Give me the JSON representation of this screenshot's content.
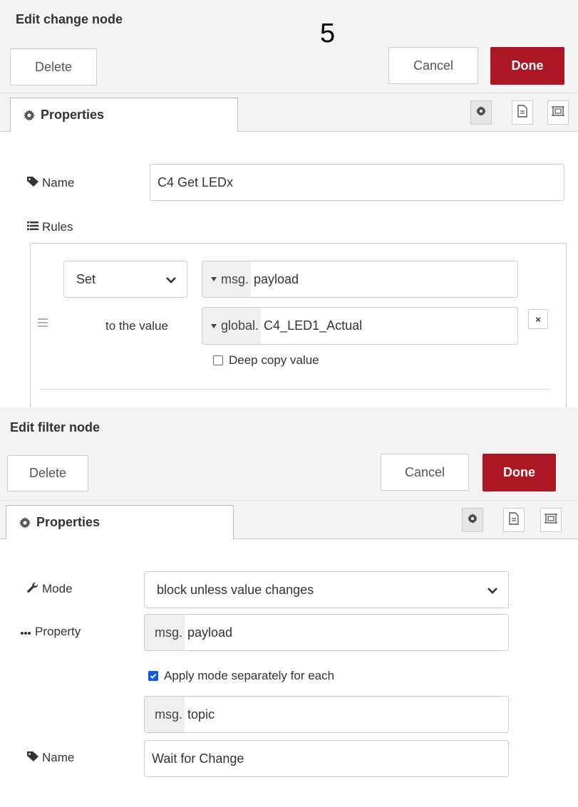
{
  "page_number": "5",
  "change_dialog": {
    "title": "Edit change node",
    "delete_label": "Delete",
    "cancel_label": "Cancel",
    "done_label": "Done",
    "tab_label": "Properties",
    "name_label": "Name",
    "name_value": "C4 Get LEDx",
    "rules_label": "Rules",
    "rule": {
      "action": "Set",
      "target_type": "msg.",
      "target_value": "payload",
      "to_the_value_label": "to the value",
      "value_type": "global.",
      "value_value": "C4_LED1_Actual",
      "deep_copy_label": "Deep copy value",
      "deep_copy_checked": false,
      "delete_rule_glyph": "×"
    }
  },
  "filter_dialog": {
    "title": "Edit filter node",
    "delete_label": "Delete",
    "cancel_label": "Cancel",
    "done_label": "Done",
    "tab_label": "Properties",
    "mode_label": "Mode",
    "mode_value": "block unless value changes",
    "property_label": "Property",
    "property_type": "msg.",
    "property_value": "payload",
    "apply_label": "Apply mode separately for each",
    "apply_checked": true,
    "apply_type": "msg.",
    "apply_value": "topic",
    "name_label": "Name",
    "name_value": "Wait for Change"
  },
  "colors": {
    "primary": "#ad1625",
    "header_bg": "#f3f3f3",
    "checkbox_checked": "#0b5fd6"
  }
}
